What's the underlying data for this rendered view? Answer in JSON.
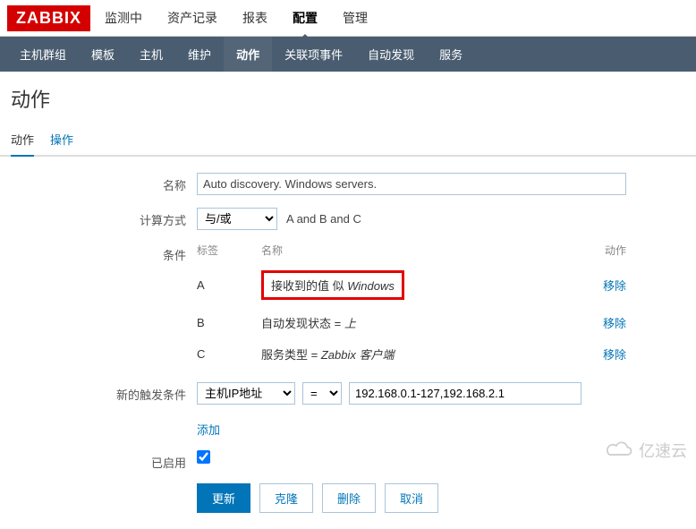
{
  "logo": "ZABBIX",
  "topnav": [
    {
      "label": "监测中",
      "active": false
    },
    {
      "label": "资产记录",
      "active": false
    },
    {
      "label": "报表",
      "active": false
    },
    {
      "label": "配置",
      "active": true
    },
    {
      "label": "管理",
      "active": false
    }
  ],
  "subnav": [
    {
      "label": "主机群组",
      "active": false
    },
    {
      "label": "模板",
      "active": false
    },
    {
      "label": "主机",
      "active": false
    },
    {
      "label": "维护",
      "active": false
    },
    {
      "label": "动作",
      "active": true
    },
    {
      "label": "关联项事件",
      "active": false
    },
    {
      "label": "自动发现",
      "active": false
    },
    {
      "label": "服务",
      "active": false
    }
  ],
  "page_title": "动作",
  "tabs": [
    {
      "label": "动作",
      "active": true
    },
    {
      "label": "操作",
      "active": false
    }
  ],
  "form": {
    "name_label": "名称",
    "name_value": "Auto discovery. Windows servers.",
    "calc_label": "计算方式",
    "calc_select": "与/或",
    "calc_hint": "A and B and C",
    "cond_label": "条件",
    "cond_head_tag": "标签",
    "cond_head_name": "名称",
    "cond_head_action": "动作",
    "conditions": [
      {
        "tag": "A",
        "name_prefix": "接收到的值 似 ",
        "name_italic": "Windows",
        "action": "移除",
        "boxed": true
      },
      {
        "tag": "B",
        "name_prefix": "自动发现状态 = ",
        "name_italic": "上",
        "action": "移除",
        "boxed": false
      },
      {
        "tag": "C",
        "name_prefix": "服务类型 = ",
        "name_italic": "Zabbix 客户端",
        "action": "移除",
        "boxed": false
      }
    ],
    "newcond_label": "新的触发条件",
    "newcond_type": "主机IP地址",
    "newcond_op": "=",
    "newcond_value": "192.168.0.1-127,192.168.2.1",
    "newcond_add": "添加",
    "enabled_label": "已启用",
    "enabled_checked": true,
    "buttons": {
      "update": "更新",
      "clone": "克隆",
      "delete": "删除",
      "cancel": "取消"
    }
  },
  "watermark": "亿速云"
}
